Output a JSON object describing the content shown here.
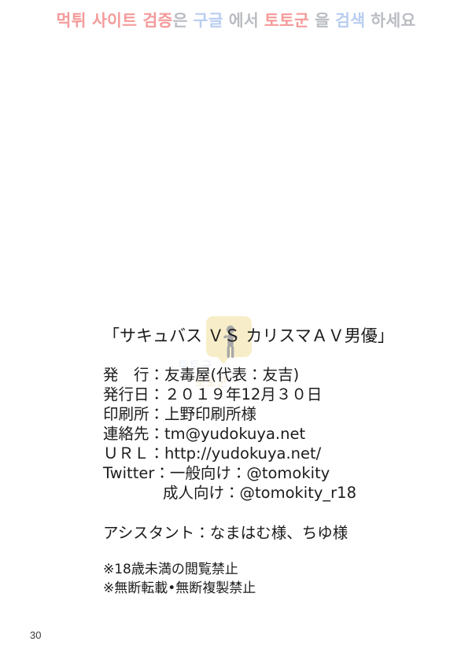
{
  "banner": {
    "segments": [
      {
        "text": "먹튀 사이트 검증",
        "color": "#f59a9a"
      },
      {
        "text": "은",
        "color": "#b9bcc2"
      },
      {
        "text": "구글",
        "color": "#b9cdf0"
      },
      {
        "text": "에서",
        "color": "#b9bcc2"
      },
      {
        "text": "토토군",
        "color": "#f59a9a"
      },
      {
        "text": "을",
        "color": "#b9bcc2"
      },
      {
        "text": "검색",
        "color": "#b9cdf0"
      },
      {
        "text": "하세요",
        "color": "#b9bcc2"
      }
    ],
    "full_text": "먹튀 사이트 검증은 구글 에서 토토군 을 검색 하세요"
  },
  "watermark": {
    "badge_color": "#f7eec9",
    "figure_color": "#a8a8a8",
    "ghost_text_1": "토토군",
    "ghost_text_2": "토토군"
  },
  "colophon": {
    "title": "「サキュバス ＶＳ カリスマＡＶ男優」",
    "publisher_label": "発　行",
    "publisher_line": "発　行：友毒屋(代表：友吉)",
    "pubdate_line": "発行日：２０１９年12月３０日",
    "printer_line": "印刷所：上野印刷所様",
    "contact_line": "連絡先：tm@yudokuya.net",
    "url_line": "ＵＲＬ：http://yudokuya.net/",
    "twitter_line": "Twitter：一般向け：@tomokity",
    "twitter_adult_line": "成人向け：@tomokity_r18",
    "assistant_line": "アシスタント：なまはむ様、ちゆ様",
    "notice_age": "※18歳未満の閲覧禁止",
    "notice_repro": "※無断転載•無断複製禁止"
  },
  "footer": {
    "page_number": "30"
  }
}
